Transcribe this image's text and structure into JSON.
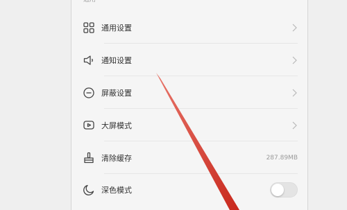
{
  "section": {
    "title": "通用"
  },
  "items": [
    {
      "icon": "grid-icon",
      "label": "通用设置",
      "action": "chevron"
    },
    {
      "icon": "speaker-icon",
      "label": "通知设置",
      "action": "chevron"
    },
    {
      "icon": "minus-circle-icon",
      "label": "屏蔽设置",
      "action": "chevron"
    },
    {
      "icon": "tv-play-icon",
      "label": "大屏模式",
      "action": "chevron"
    },
    {
      "icon": "broom-icon",
      "label": "清除缓存",
      "value": "287.89MB"
    },
    {
      "icon": "moon-icon",
      "label": "深色模式",
      "toggle_on": false
    }
  ],
  "colors": {
    "annotation_arrow": "#d23a2a",
    "toggle_off": "#e4e4e4"
  }
}
